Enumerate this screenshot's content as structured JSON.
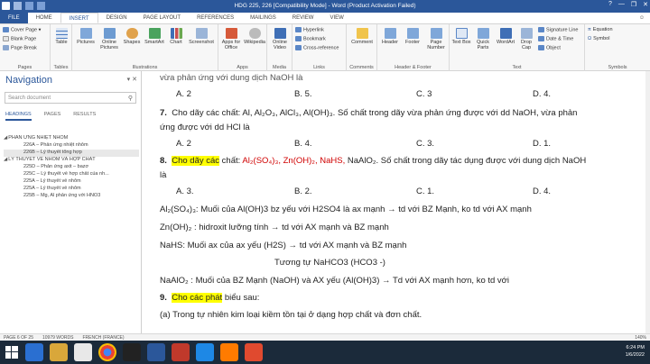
{
  "window": {
    "title": "HDG 225, 226 [Compatibility Mode] - Word (Product Activation Failed)",
    "controls": [
      "?",
      "—",
      "❐",
      "✕"
    ]
  },
  "tabs": [
    "FILE",
    "HOME",
    "INSERT",
    "DESIGN",
    "PAGE LAYOUT",
    "REFERENCES",
    "MAILINGS",
    "REVIEW",
    "VIEW"
  ],
  "active_tab": "INSERT",
  "ribbon": {
    "pages": {
      "label": "Pages",
      "items": [
        "Cover Page ▾",
        "Blank Page",
        "Page Break"
      ]
    },
    "tables": {
      "label": "Tables",
      "table": "Table"
    },
    "illustrations": {
      "label": "Illustrations",
      "items": [
        "Pictures",
        "Online Pictures",
        "Shapes",
        "SmartArt",
        "Chart",
        "Screenshot"
      ]
    },
    "apps": {
      "label": "Apps",
      "items": [
        "Apps for Office",
        "Wikipedia"
      ]
    },
    "media": {
      "label": "Media",
      "items": [
        "Online Video"
      ]
    },
    "links": {
      "label": "Links",
      "items": [
        "Hyperlink",
        "Bookmark",
        "Cross-reference"
      ]
    },
    "comments": {
      "label": "Comments",
      "items": [
        "Comment"
      ]
    },
    "header_footer": {
      "label": "Header & Footer",
      "items": [
        "Header",
        "Footer",
        "Page Number"
      ]
    },
    "text": {
      "label": "Text",
      "items": [
        "Text Box",
        "Quick Parts",
        "WordArt",
        "Drop Cap"
      ],
      "small": [
        "Signature Line",
        "Date & Time",
        "Object"
      ]
    },
    "symbols": {
      "label": "Symbols",
      "items": [
        "Equation",
        "Symbol"
      ]
    }
  },
  "nav": {
    "title": "Navigation",
    "search_placeholder": "Search document",
    "tabs": [
      "HEADINGS",
      "PAGES",
      "RESULTS"
    ],
    "tree": [
      {
        "text": "PHẢN ỨNG NHIỆT NHÔM",
        "level": 1
      },
      {
        "text": "226A – Phản ứng nhiệt nhôm",
        "level": 2
      },
      {
        "text": "226B – Lý thuyết tổng hợp",
        "level": 2,
        "selected": true
      },
      {
        "text": "LÝ THUYẾT VỀ NHÔM VÀ HỢP CHẤT",
        "level": 1
      },
      {
        "text": "225D – Phản ứng axit – bazơ",
        "level": 2
      },
      {
        "text": "225C – Lý thuyết về hợp chất của nh...",
        "level": 2
      },
      {
        "text": "225A – Lý thuyết về nhôm",
        "level": 2
      },
      {
        "text": "225A – Lý thuyết về nhôm",
        "level": 2
      },
      {
        "text": "225B – Mg, Al phản ứng với HNO3",
        "level": 2
      }
    ]
  },
  "doc": {
    "cut_top": "vừa phản ứng với dung dịch NaOH là",
    "opts6": [
      "A. 2",
      "B. 5.",
      "C. 3",
      "D. 4."
    ],
    "q7_num": "7.",
    "q7_a": "Cho dãy các chất: Al, Al₂O₃, AlCl₃, Al(OH)₃. Số chất trong dãy vừa phản ứng được với dd NaOH, vừa phản",
    "q7_b": "ứng được với dd HCl là",
    "opts7": [
      "A. 2",
      "B. 4.",
      "C. 3.",
      "D. 1."
    ],
    "q8_num": "8.",
    "q8_hl": "Cho dãy các",
    "q8_pre": " chất: ",
    "q8_red": "Al₂(SO₄)₃, Zn(OH)₂, NaHS,",
    "q8_post": " NaAlO₂. Số chất trong dãy tác dụng được với dung dịch NaOH",
    "q8_b": "là",
    "opts8": [
      "A. 3.",
      "B. 2.",
      "C. 1.",
      "D. 4."
    ],
    "n1": "Al₂(SO₄)₃: Muối của Al(OH)3 bz yếu với H2SO4 là ax mạnh → td với BZ Mạnh, ko td với AX mạnh",
    "n2": "Zn(OH)₂ : hidroxit lưỡng tính → td với AX mạnh và BZ mạnh",
    "n3": "NaHS: Muối ax của ax yếu (H2S) → td với AX mạnh và BZ mạnh",
    "n4": "Tương tự NaHCO3 (HCO3 -)",
    "n5": "NaAlO₂ : Muối của BZ Mạnh (NaOH) và AX yếu (Al(OH)3) → Td với AX mạnh hơn, ko td với",
    "q9_num": "9.",
    "q9_hl": "Cho các phát",
    "q9_post": " biểu sau:",
    "q9_a": "(a) Trong tự nhiên kim loại kiềm tồn tại ở dạng hợp chất và đơn chất."
  },
  "status": {
    "page": "PAGE 6 OF 25",
    "words": "10979 WORDS",
    "lang": "FRENCH (FRANCE)",
    "zoom": "140%"
  },
  "tray": {
    "time": "6:24 PM",
    "date": "1/6/2022"
  },
  "colors": {
    "word_blue": "#2b579a",
    "highlight": "#ffff00",
    "red_text": "#d00000"
  }
}
